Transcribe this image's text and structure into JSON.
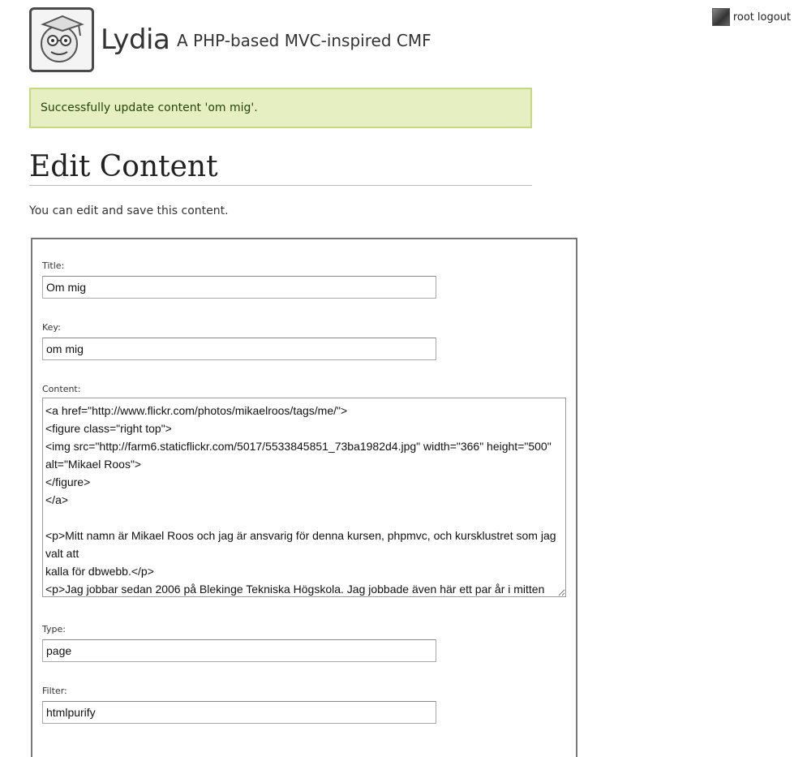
{
  "header": {
    "site_title": "Lydia",
    "site_slogan": "A PHP-based MVC-inspired CMF",
    "logo_icon": "graduate-face-logo"
  },
  "login_menu": {
    "username": "root",
    "logout_label": "logout"
  },
  "flash": {
    "message": "Successfully update content 'om mig'.",
    "color": "#e6efc2"
  },
  "main": {
    "title": "Edit Content",
    "intro": "You can edit and save this content."
  },
  "form": {
    "title_label": "Title:",
    "title_value": "Om mig",
    "key_label": "Key:",
    "key_value": "om mig",
    "content_label": "Content:",
    "content_value": "<a href=\"http://www.flickr.com/photos/mikaelroos/tags/me/\">\n<figure class=\"right top\">\n<img src=\"http://farm6.staticflickr.com/5017/5533845851_73ba1982d4.jpg\" width=\"366\" height=\"500\" alt=\"Mikael Roos\">\n</figure>\n</a>\n\n<p>Mitt namn är Mikael Roos och jag är ansvarig för denna kursen, phpmvc, och kursklustret som jag valt att\nkalla för dbwebb.</p>\n<p>Jag jobbar sedan 2006 på Blekinge Tekniska Högskola. Jag jobbade även här ett par år i mitten",
    "type_label": "Type:",
    "type_value": "page",
    "filter_label": "Filter:",
    "filter_value": "htmlpurify"
  }
}
